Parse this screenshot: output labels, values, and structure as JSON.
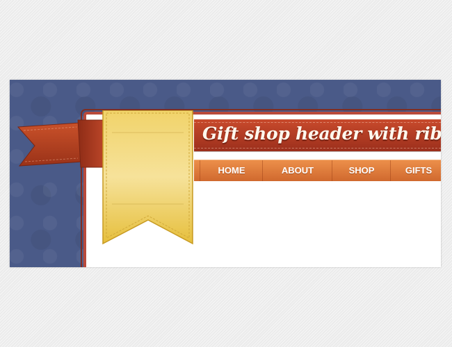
{
  "header": {
    "title": "Gift shop header with ribbons"
  },
  "nav": {
    "items": [
      {
        "label": "HOME"
      },
      {
        "label": "ABOUT"
      },
      {
        "label": "SHOP"
      },
      {
        "label": "GIFTS"
      }
    ]
  },
  "colors": {
    "background_pattern": "#4a5a88",
    "title_ribbon": "#b73e24",
    "nav_bar": "#e07a3c",
    "bookmark_ribbon": "#f2d46a",
    "flag_ribbon": "#b8401f"
  }
}
